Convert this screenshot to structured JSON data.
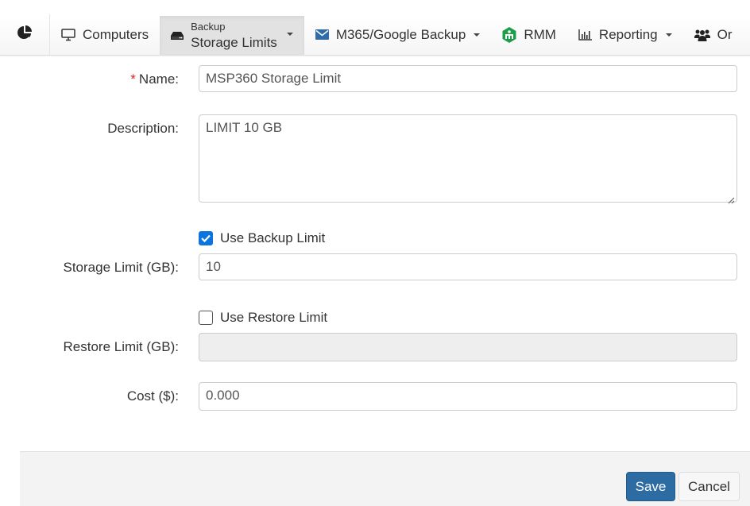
{
  "nav": {
    "logo_icon": "pie-chart-icon",
    "items": [
      {
        "label": "Computers",
        "icon": "monitor-icon"
      },
      {
        "small_label": "Backup",
        "label": "Storage Limits",
        "icon": "hard-drive-icon",
        "active": true,
        "dropdown": true
      },
      {
        "label": "M365/Google Backup",
        "icon": "envelope-icon",
        "dropdown": true,
        "icon_color": "#2f6ca8"
      },
      {
        "label": "RMM",
        "icon": "rmm-hexagon-icon",
        "icon_color": "#1e9e4a"
      },
      {
        "label": "Reporting",
        "icon": "bar-chart-icon",
        "dropdown": true
      },
      {
        "label": "Or",
        "icon": "users-icon"
      }
    ]
  },
  "form": {
    "name": {
      "label": "Name:",
      "required_mark": "*",
      "value": "MSP360 Storage Limit"
    },
    "description": {
      "label": "Description:",
      "value": "LIMIT 10 GB"
    },
    "use_backup_limit": {
      "label": "Use Backup Limit",
      "checked": true
    },
    "storage_limit": {
      "label": "Storage Limit (GB):",
      "value": "10"
    },
    "use_restore_limit": {
      "label": "Use Restore Limit",
      "checked": false
    },
    "restore_limit": {
      "label": "Restore Limit (GB):",
      "value": "",
      "disabled": true
    },
    "cost": {
      "label": "Cost ($):",
      "value": "0.000"
    }
  },
  "footer": {
    "save_label": "Save",
    "cancel_label": "Cancel"
  },
  "colors": {
    "primary": "#2d6ca2",
    "checkbox": "#0b74de",
    "required": "#e02020",
    "rmm_green": "#1e9e4a",
    "mail_blue": "#2f6ca8"
  }
}
